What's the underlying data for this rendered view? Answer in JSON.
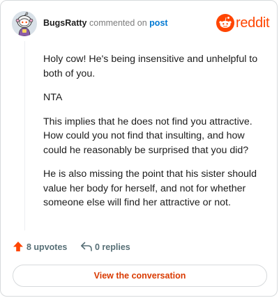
{
  "header": {
    "username": "BugsRatty",
    "action_text": "commented on",
    "link_text": "post",
    "brand_name": "reddit"
  },
  "comment": {
    "paragraphs": [
      "Holy cow! He's being insensitive and unhelpful to both of you.",
      "NTA",
      "This implies that he does not find you attractive. How could you not find that insulting, and how could he reasonably be surprised that you did?",
      "He is also missing the point that his sister should value her body for herself, and not for whether someone else will find her attractive or not."
    ]
  },
  "actions": {
    "upvotes_label": "8 upvotes",
    "replies_label": "0 replies"
  },
  "cta": {
    "label": "View the conversation"
  },
  "icons": {
    "avatar": "snoo-avatar-icon",
    "brand": "reddit-snoo-icon",
    "upvote": "upvote-arrow-icon",
    "reply": "reply-arrow-icon"
  },
  "colors": {
    "brand": "#ff4500",
    "link": "#0079d3",
    "upvote": "#ff4500",
    "cta_text": "#d93a00",
    "muted": "#576f76",
    "border": "#d7dadc"
  }
}
